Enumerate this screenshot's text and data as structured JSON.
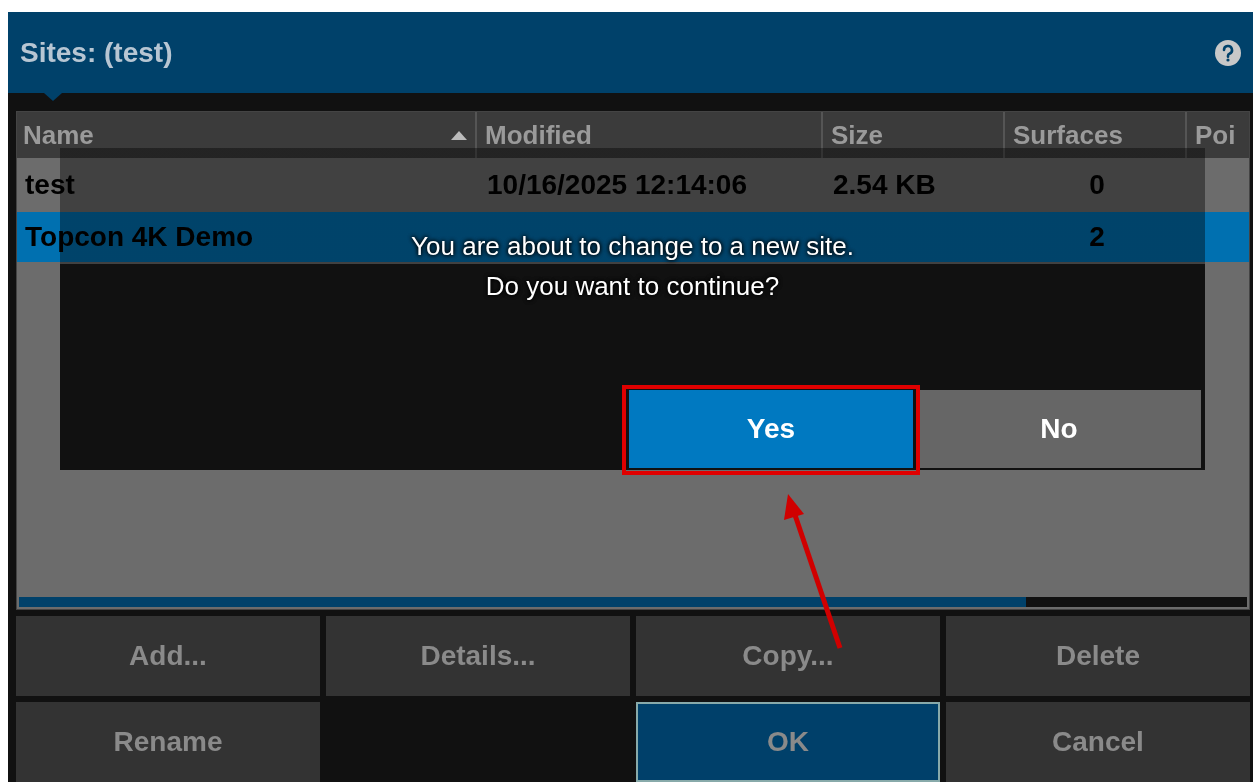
{
  "window": {
    "title": "Sites: (test)"
  },
  "table": {
    "columns": [
      {
        "label": "Name",
        "sorted": true
      },
      {
        "label": "Modified",
        "sorted": false
      },
      {
        "label": "Size",
        "sorted": false
      },
      {
        "label": "Surfaces",
        "sorted": false
      },
      {
        "label": "Poi",
        "sorted": false
      }
    ],
    "rows": [
      {
        "selected": false,
        "cells": [
          "test",
          "10/16/2025 12:14:06",
          "2.54 KB",
          "0",
          null
        ]
      },
      {
        "selected": true,
        "cells": [
          "Topcon 4K Demo",
          null,
          null,
          "2",
          null
        ]
      }
    ]
  },
  "buttons": [
    {
      "label": "Add...",
      "kind": "plain"
    },
    {
      "label": "Details...",
      "kind": "plain"
    },
    {
      "label": "Copy...",
      "kind": "plain"
    },
    {
      "label": "Delete",
      "kind": "plain"
    },
    {
      "label": "Rename",
      "kind": "plain"
    },
    {
      "kind": "empty"
    },
    {
      "label": "OK",
      "kind": "primary"
    },
    {
      "label": "Cancel",
      "kind": "plain"
    }
  ],
  "dialog": {
    "message": [
      "You are about to change to a new site.",
      "Do you want to continue?"
    ],
    "buttons": [
      {
        "label": "Yes",
        "kind": "primary",
        "highlighted": true
      },
      {
        "label": "No",
        "kind": "plain",
        "highlighted": false
      }
    ]
  }
}
